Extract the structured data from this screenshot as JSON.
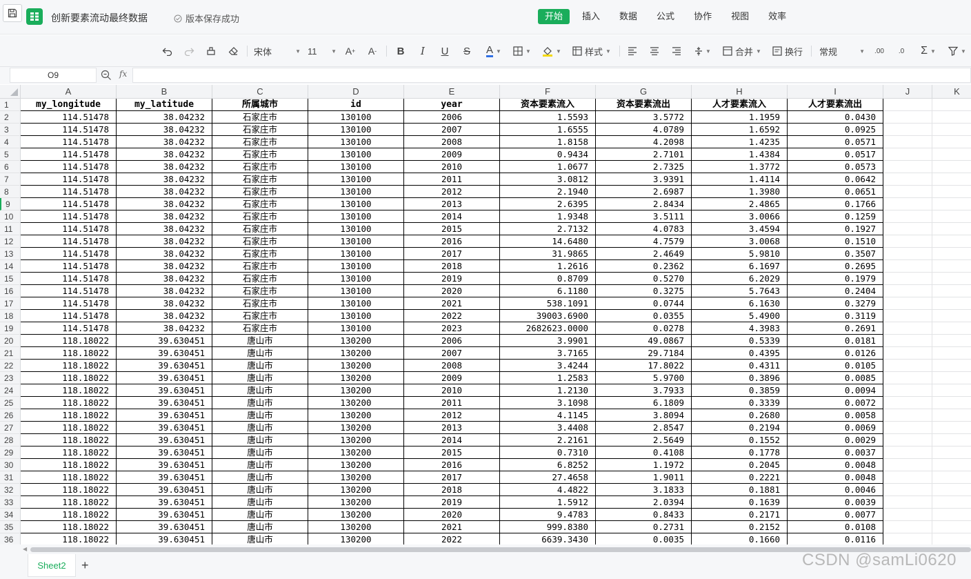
{
  "app": {
    "file_title": "创新要素流动最终数据",
    "save_status": "版本保存成功",
    "brand_color": "#1aad5b"
  },
  "tabs": [
    {
      "label": "开始",
      "active": true
    },
    {
      "label": "插入",
      "active": false
    },
    {
      "label": "数据",
      "active": false
    },
    {
      "label": "公式",
      "active": false
    },
    {
      "label": "协作",
      "active": false
    },
    {
      "label": "视图",
      "active": false
    },
    {
      "label": "效率",
      "active": false
    }
  ],
  "toolbar": {
    "font_name": "宋体",
    "font_size": "11",
    "styles_label": "样式",
    "merge_label": "合并",
    "wrap_label": "换行",
    "number_format": "常规"
  },
  "formula_bar": {
    "cell_ref": "O9",
    "fx_label": "fx",
    "formula": ""
  },
  "columns": [
    "A",
    "B",
    "C",
    "D",
    "E",
    "F",
    "G",
    "H",
    "I",
    "J",
    "K"
  ],
  "headers": [
    "my_longitude",
    "my_latitude",
    "所属城市",
    "id",
    "year",
    "资本要素流入",
    "资本要素流出",
    "人才要素流入",
    "人才要素流出"
  ],
  "rows": [
    [
      "114.51478",
      "38.04232",
      "石家庄市",
      "130100",
      "2006",
      "1.5593",
      "3.5772",
      "1.1959",
      "0.0430"
    ],
    [
      "114.51478",
      "38.04232",
      "石家庄市",
      "130100",
      "2007",
      "1.6555",
      "4.0789",
      "1.6592",
      "0.0925"
    ],
    [
      "114.51478",
      "38.04232",
      "石家庄市",
      "130100",
      "2008",
      "1.8158",
      "4.2098",
      "1.4235",
      "0.0571"
    ],
    [
      "114.51478",
      "38.04232",
      "石家庄市",
      "130100",
      "2009",
      "0.9434",
      "2.7101",
      "1.4384",
      "0.0517"
    ],
    [
      "114.51478",
      "38.04232",
      "石家庄市",
      "130100",
      "2010",
      "1.0677",
      "2.7325",
      "1.3772",
      "0.0573"
    ],
    [
      "114.51478",
      "38.04232",
      "石家庄市",
      "130100",
      "2011",
      "3.0812",
      "3.9391",
      "1.4114",
      "0.0642"
    ],
    [
      "114.51478",
      "38.04232",
      "石家庄市",
      "130100",
      "2012",
      "2.1940",
      "2.6987",
      "1.3980",
      "0.0651"
    ],
    [
      "114.51478",
      "38.04232",
      "石家庄市",
      "130100",
      "2013",
      "2.6395",
      "2.8434",
      "2.4865",
      "0.1766"
    ],
    [
      "114.51478",
      "38.04232",
      "石家庄市",
      "130100",
      "2014",
      "1.9348",
      "3.5111",
      "3.0066",
      "0.1259"
    ],
    [
      "114.51478",
      "38.04232",
      "石家庄市",
      "130100",
      "2015",
      "2.7132",
      "4.0783",
      "3.4594",
      "0.1927"
    ],
    [
      "114.51478",
      "38.04232",
      "石家庄市",
      "130100",
      "2016",
      "14.6480",
      "4.7579",
      "3.0068",
      "0.1510"
    ],
    [
      "114.51478",
      "38.04232",
      "石家庄市",
      "130100",
      "2017",
      "31.9865",
      "2.4649",
      "5.9810",
      "0.3507"
    ],
    [
      "114.51478",
      "38.04232",
      "石家庄市",
      "130100",
      "2018",
      "1.2616",
      "0.2362",
      "6.1697",
      "0.2695"
    ],
    [
      "114.51478",
      "38.04232",
      "石家庄市",
      "130100",
      "2019",
      "0.8709",
      "0.5270",
      "6.2029",
      "0.1979"
    ],
    [
      "114.51478",
      "38.04232",
      "石家庄市",
      "130100",
      "2020",
      "6.1180",
      "0.3275",
      "5.7643",
      "0.2404"
    ],
    [
      "114.51478",
      "38.04232",
      "石家庄市",
      "130100",
      "2021",
      "538.1091",
      "0.0744",
      "6.1630",
      "0.3279"
    ],
    [
      "114.51478",
      "38.04232",
      "石家庄市",
      "130100",
      "2022",
      "39003.6900",
      "0.0355",
      "5.4900",
      "0.3119"
    ],
    [
      "114.51478",
      "38.04232",
      "石家庄市",
      "130100",
      "2023",
      "2682623.0000",
      "0.0278",
      "4.3983",
      "0.2691"
    ],
    [
      "118.18022",
      "39.630451",
      "唐山市",
      "130200",
      "2006",
      "3.9901",
      "49.0867",
      "0.5339",
      "0.0181"
    ],
    [
      "118.18022",
      "39.630451",
      "唐山市",
      "130200",
      "2007",
      "3.7165",
      "29.7184",
      "0.4395",
      "0.0126"
    ],
    [
      "118.18022",
      "39.630451",
      "唐山市",
      "130200",
      "2008",
      "3.4244",
      "17.8022",
      "0.4311",
      "0.0105"
    ],
    [
      "118.18022",
      "39.630451",
      "唐山市",
      "130200",
      "2009",
      "1.2583",
      "5.9700",
      "0.3896",
      "0.0085"
    ],
    [
      "118.18022",
      "39.630451",
      "唐山市",
      "130200",
      "2010",
      "1.2130",
      "3.7933",
      "0.3859",
      "0.0094"
    ],
    [
      "118.18022",
      "39.630451",
      "唐山市",
      "130200",
      "2011",
      "3.1098",
      "6.1809",
      "0.3339",
      "0.0072"
    ],
    [
      "118.18022",
      "39.630451",
      "唐山市",
      "130200",
      "2012",
      "4.1145",
      "3.8094",
      "0.2680",
      "0.0058"
    ],
    [
      "118.18022",
      "39.630451",
      "唐山市",
      "130200",
      "2013",
      "3.4408",
      "2.8547",
      "0.2194",
      "0.0069"
    ],
    [
      "118.18022",
      "39.630451",
      "唐山市",
      "130200",
      "2014",
      "2.2161",
      "2.5649",
      "0.1552",
      "0.0029"
    ],
    [
      "118.18022",
      "39.630451",
      "唐山市",
      "130200",
      "2015",
      "0.7310",
      "0.4108",
      "0.1778",
      "0.0037"
    ],
    [
      "118.18022",
      "39.630451",
      "唐山市",
      "130200",
      "2016",
      "6.8252",
      "1.1972",
      "0.2045",
      "0.0048"
    ],
    [
      "118.18022",
      "39.630451",
      "唐山市",
      "130200",
      "2017",
      "27.4658",
      "1.9011",
      "0.2221",
      "0.0048"
    ],
    [
      "118.18022",
      "39.630451",
      "唐山市",
      "130200",
      "2018",
      "4.4822",
      "3.1833",
      "0.1881",
      "0.0046"
    ],
    [
      "118.18022",
      "39.630451",
      "唐山市",
      "130200",
      "2019",
      "1.5912",
      "2.0394",
      "0.1639",
      "0.0039"
    ],
    [
      "118.18022",
      "39.630451",
      "唐山市",
      "130200",
      "2020",
      "9.4783",
      "0.8433",
      "0.2171",
      "0.0077"
    ],
    [
      "118.18022",
      "39.630451",
      "唐山市",
      "130200",
      "2021",
      "999.8380",
      "0.2731",
      "0.2152",
      "0.0108"
    ],
    [
      "118.18022",
      "39.630451",
      "唐山市",
      "130200",
      "2022",
      "6639.3430",
      "0.0035",
      "0.1660",
      "0.0116"
    ]
  ],
  "active_row": 9,
  "sheets": [
    {
      "label": "Sheet2",
      "active": true
    }
  ],
  "watermark": "CSDN @samLi0620"
}
